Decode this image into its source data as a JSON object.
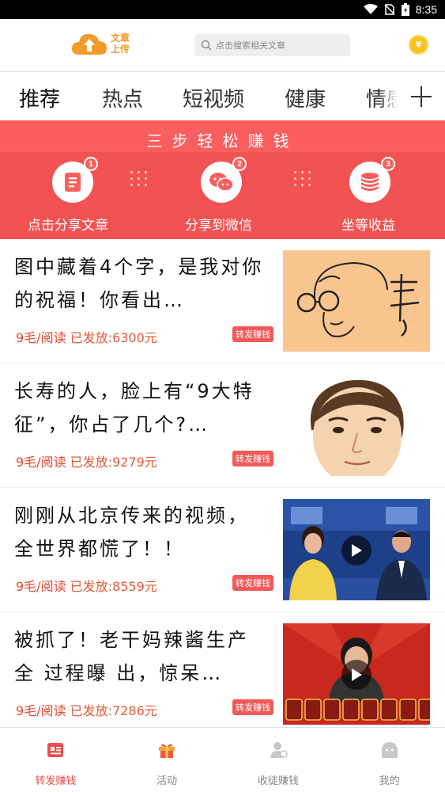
{
  "status_bar": {
    "time": "8:35"
  },
  "header": {
    "logo_line1": "文章",
    "logo_line2": "上传",
    "search_placeholder": "点击搜索相关文章",
    "coin_symbol": "¥"
  },
  "tabs": [
    {
      "label": "推荐",
      "active": true
    },
    {
      "label": "热点",
      "active": false
    },
    {
      "label": "短视频",
      "active": false
    },
    {
      "label": "健康",
      "active": false
    },
    {
      "label": "情感",
      "active": false
    }
  ],
  "banner": {
    "title": "三步轻松赚钱",
    "steps": [
      {
        "number": "1",
        "label": "点击分享文章",
        "icon": "document-icon"
      },
      {
        "number": "2",
        "label": "分享到微信",
        "icon": "wechat-icon"
      },
      {
        "number": "3",
        "label": "坐等收益",
        "icon": "coins-icon"
      }
    ]
  },
  "articles": [
    {
      "title": "图中藏着4个字，是我对你的祝福！你看出…",
      "price": "9毛/阅读",
      "paid": "已发放:6300元",
      "tag": "转发赚钱",
      "thumb": "cartoon-face",
      "video": false
    },
    {
      "title": "长寿的人，脸上有“9大特征”，你占了几个?…",
      "price": "9毛/阅读",
      "paid": "已发放:9279元",
      "tag": "转发赚钱",
      "thumb": "man-face",
      "video": false
    },
    {
      "title": "刚刚从北京传来的视频，全世界都慌了！！",
      "price": "9毛/阅读",
      "paid": "已发放:8559元",
      "tag": "转发赚钱",
      "thumb": "news-anchors",
      "video": true
    },
    {
      "title": "被抓了！老干妈辣酱生产全 过程曝 出，惊呆…",
      "price": "9毛/阅读",
      "paid": "已发放:7286元",
      "tag": "转发赚钱",
      "thumb": "sauce-jars",
      "video": true
    }
  ],
  "bottom_nav": [
    {
      "label": "转发赚钱",
      "icon": "share-earn-icon",
      "active": true
    },
    {
      "label": "活动",
      "icon": "gift-icon",
      "active": false
    },
    {
      "label": "收徒赚钱",
      "icon": "person-icon",
      "active": false
    },
    {
      "label": "我的",
      "icon": "profile-icon",
      "active": false
    }
  ],
  "colors": {
    "accent": "#fb5e5e",
    "logo": "#f39a2b",
    "price": "#e8482f"
  }
}
